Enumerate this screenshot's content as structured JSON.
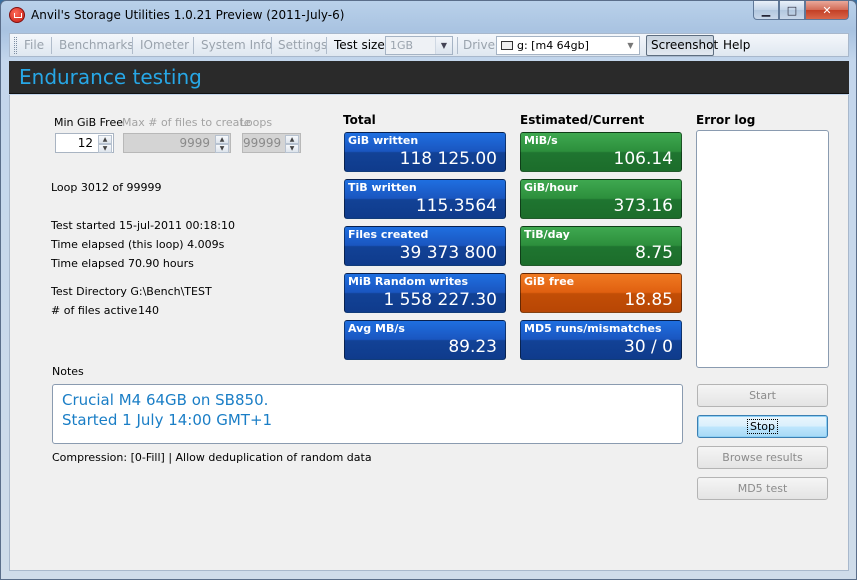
{
  "window": {
    "title": "Anvil's Storage Utilities 1.0.21 Preview (2011-July-6)"
  },
  "caption_buttons": {
    "minimize": "▁",
    "maximize": "□",
    "close": "✕"
  },
  "toolbar": {
    "file": "File",
    "benchmarks": "Benchmarks",
    "iometer": "IOmeter",
    "system_info": "System Info",
    "settings": "Settings",
    "test_size_label": "Test size",
    "test_size_value": "1GB",
    "drive_label": "Drive",
    "drive_value": "g: [m4 64gb]",
    "screenshot": "Screenshot",
    "help": "Help"
  },
  "header": {
    "title": "Endurance testing"
  },
  "settings": {
    "min_free_label": "Min GiB Free",
    "min_free_value": "12",
    "max_files_label": "Max # of files to create",
    "max_files_value": "9999",
    "loops_label": "Loops",
    "loops_value": "99999"
  },
  "status": {
    "loop": "Loop 3012 of 99999",
    "test_started": "Test started 15-jul-2011 00:18:10",
    "elapsed_loop": "Time elapsed (this loop) 4.009s",
    "elapsed_total": "Time elapsed 70.90 hours",
    "test_directory": "Test Directory G:\\Bench\\TEST",
    "files_active_label": "# of files active",
    "files_active_value": "140"
  },
  "columns": {
    "total": "Total",
    "estimated": "Estimated/Current",
    "error_log": "Error log"
  },
  "total_tiles": [
    {
      "label": "GiB written",
      "value": "118 125.00"
    },
    {
      "label": "TiB written",
      "value": "115.3564"
    },
    {
      "label": "Files created",
      "value": "39 373 800"
    },
    {
      "label": "MiB Random writes",
      "value": "1 558 227.30"
    },
    {
      "label": "Avg MB/s",
      "value": "89.23"
    }
  ],
  "estimated_tiles": [
    {
      "label": "MiB/s",
      "value": "106.14",
      "color": "green"
    },
    {
      "label": "GiB/hour",
      "value": "373.16",
      "color": "green"
    },
    {
      "label": "TiB/day",
      "value": "8.75",
      "color": "green"
    },
    {
      "label": "GiB free",
      "value": "18.85",
      "color": "orange"
    },
    {
      "label": "MD5 runs/mismatches",
      "value": "30 / 0",
      "color": "blue"
    }
  ],
  "notes": {
    "label": "Notes",
    "line1": "Crucial M4 64GB on SB850.",
    "line2": "Started 1 July 14:00 GMT+1"
  },
  "compression": "Compression: [0-Fill] | Allow deduplication of random data",
  "buttons": {
    "start": "Start",
    "stop": "Stop",
    "browse": "Browse results",
    "md5": "MD5 test"
  },
  "colors": {
    "header_text": "#27a7e6",
    "tile_blue": "#1a56c0",
    "tile_green": "#2c8f3c",
    "tile_orange": "#e06010",
    "notes_text": "#1a7ec6"
  }
}
